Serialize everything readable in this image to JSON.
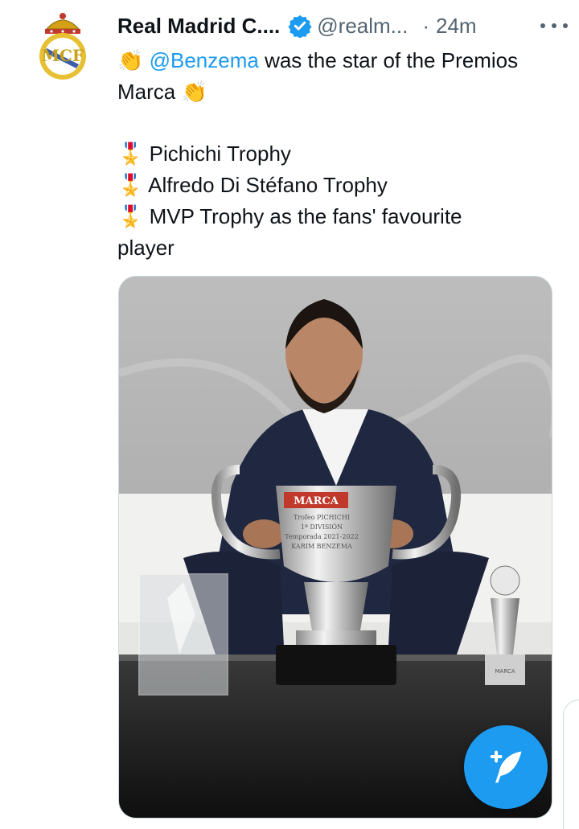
{
  "author": {
    "name": "Real Madrid C....",
    "handle": "@realm...",
    "separator": "·",
    "time": "24m",
    "avatar_icon": "real-madrid-crest-icon",
    "verified_icon": "verified-badge-icon"
  },
  "more_icon": "more-options-icon",
  "tweet": {
    "line1_emoji": "👏",
    "mention": "@Benzema",
    "line1_rest": " was the star of the Premios",
    "line2_text": "Marca ",
    "line2_emoji": "👏",
    "items": [
      {
        "emoji": "🎖️",
        "text": "Pichichi Trophy"
      },
      {
        "emoji": "🎖️",
        "text": "Alfredo Di Stéfano Trophy"
      },
      {
        "emoji": "🎖️",
        "text": "MVP Trophy as the fans' favourite"
      }
    ],
    "last_line": "player"
  },
  "media": {
    "trophy_label": "MARCA",
    "plaque_lines": [
      "Trofeo PICHICHI",
      "1ª DIVISIÓN",
      "Temporada 2021-2022",
      "KARIM BENZEMA"
    ],
    "small_trophy_label": "MARCA"
  },
  "compose_button": {
    "icon": "compose-feather-icon"
  },
  "colors": {
    "accent": "#1d9bf0",
    "text": "#0f1419",
    "muted": "#536471"
  }
}
